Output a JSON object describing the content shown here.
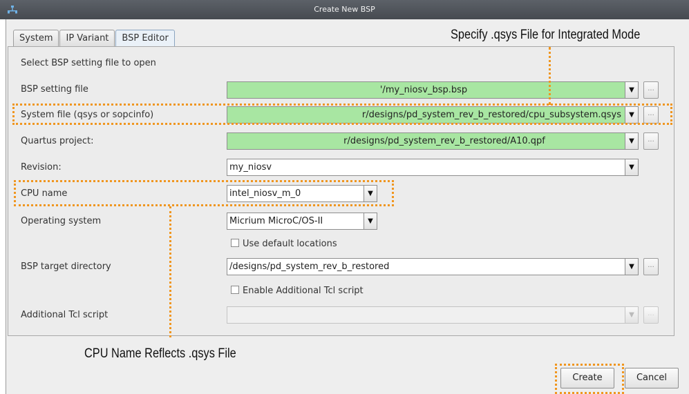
{
  "window": {
    "title": "Create New BSP"
  },
  "tabs": [
    {
      "label": "System",
      "active": false
    },
    {
      "label": "IP Variant",
      "active": false
    },
    {
      "label": "BSP Editor",
      "active": true
    }
  ],
  "form": {
    "instruction": "Select BSP setting file to open",
    "bsp_setting_file": {
      "label": "BSP setting file",
      "value": "'/my_niosv_bsp.bsp"
    },
    "system_file": {
      "label": "System file (qsys or sopcinfo)",
      "value": "r/designs/pd_system_rev_b_restored/cpu_subsystem.qsys"
    },
    "quartus_project": {
      "label": "Quartus project:",
      "value": "r/designs/pd_system_rev_b_restored/A10.qpf"
    },
    "revision": {
      "label": "Revision:",
      "value": "my_niosv"
    },
    "cpu_name": {
      "label": "CPU name",
      "value": "intel_niosv_m_0"
    },
    "operating_system": {
      "label": "Operating system",
      "value": "Micrium MicroC/OS-II"
    },
    "use_default_locations": {
      "label": "Use default locations",
      "checked": false
    },
    "bsp_target_directory": {
      "label": "BSP target directory",
      "value": "/designs/pd_system_rev_b_restored"
    },
    "enable_tcl": {
      "label": "Enable Additional Tcl script",
      "checked": false
    },
    "additional_tcl": {
      "label": "Additional Tcl script",
      "value": ""
    },
    "browse_label": "...",
    "dropdown_glyph": "▼"
  },
  "buttons": {
    "create": "Create",
    "cancel": "Cancel"
  },
  "annotations": {
    "specify_qsys": "Specify .qsys File for Integrated Mode",
    "cpu_name_reflects": "CPU Name Reflects .qsys File"
  },
  "colors": {
    "highlight_green": "#a8e6a2",
    "callout_orange": "#f0961f"
  }
}
